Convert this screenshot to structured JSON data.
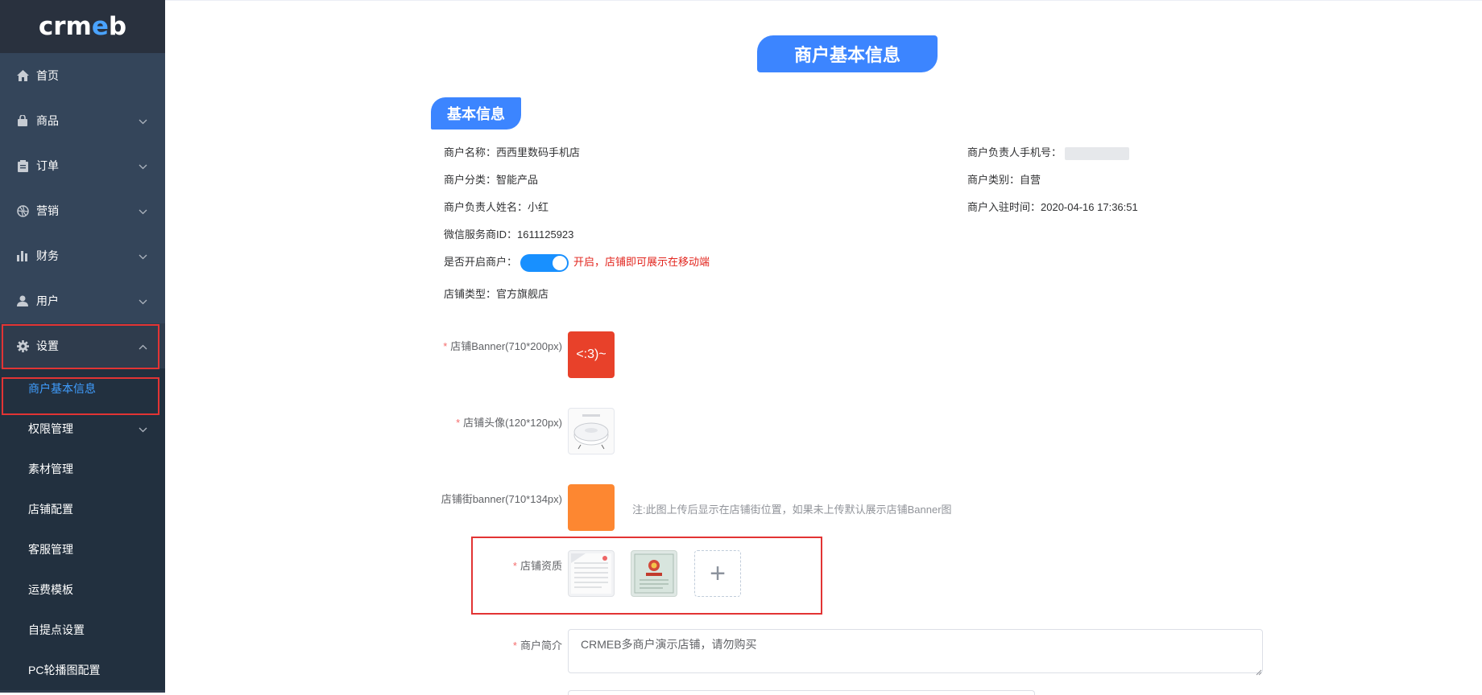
{
  "logo": {
    "text_a": "crm",
    "text_b": "e",
    "text_c": "b"
  },
  "sidebar": {
    "items": [
      {
        "label": "首页",
        "icon": "home-icon"
      },
      {
        "label": "商品",
        "icon": "shopping-bag-icon"
      },
      {
        "label": "订单",
        "icon": "clipboard-icon"
      },
      {
        "label": "营销",
        "icon": "aperture-icon"
      },
      {
        "label": "财务",
        "icon": "bar-chart-icon"
      },
      {
        "label": "用户",
        "icon": "user-icon"
      },
      {
        "label": "设置",
        "icon": "gear-icon"
      }
    ],
    "sub_items": [
      {
        "label": "商户基本信息"
      },
      {
        "label": "权限管理"
      },
      {
        "label": "素材管理"
      },
      {
        "label": "店铺配置"
      },
      {
        "label": "客服管理"
      },
      {
        "label": "运费模板"
      },
      {
        "label": "自提点设置"
      },
      {
        "label": "PC轮播图配置"
      }
    ]
  },
  "page": {
    "title": "商户基本信息",
    "section_title": "基本信息"
  },
  "info": {
    "merchant_name_label": "商户名称：",
    "merchant_name": "西西里数码手机店",
    "category_label": "商户分类：",
    "category": "智能产品",
    "owner_name_label": "商户负责人姓名：",
    "owner_name": "小红",
    "wechat_id_label": "微信服务商ID：",
    "wechat_id": "1611125923",
    "enable_label": "是否开启商户：",
    "enable_text": "开启，店铺即可展示在移动端",
    "enabled": true,
    "shop_type_label": "店铺类型：",
    "shop_type": "官方旗舰店",
    "phone_label": "商户负责人手机号：",
    "type_label": "商户类别：",
    "type": "自营",
    "join_time_label": "商户入驻时间：",
    "join_time": "2020-04-16 17:36:51"
  },
  "form": {
    "banner_label": "店铺Banner(710*200px)",
    "banner_text": "<:3)~",
    "avatar_label": "店铺头像(120*120px)",
    "street_banner_label": "店铺街banner(710*134px)",
    "street_banner_note": "注:此图上传后显示在店铺街位置，如果未上传默认展示店铺Banner图",
    "qualification_label": "店铺资质",
    "intro_label": "商户简介",
    "intro_value": "CRMEB多商户演示店铺，请勿购买",
    "upload_plus": "+"
  },
  "colors": {
    "sidebar_bg": "#2f3c4d",
    "accent": "#3c85ff",
    "highlight_red": "#e23434",
    "switch_on": "#1890ff",
    "banner_red": "#e8412a",
    "street_orange": "#fd8731"
  }
}
